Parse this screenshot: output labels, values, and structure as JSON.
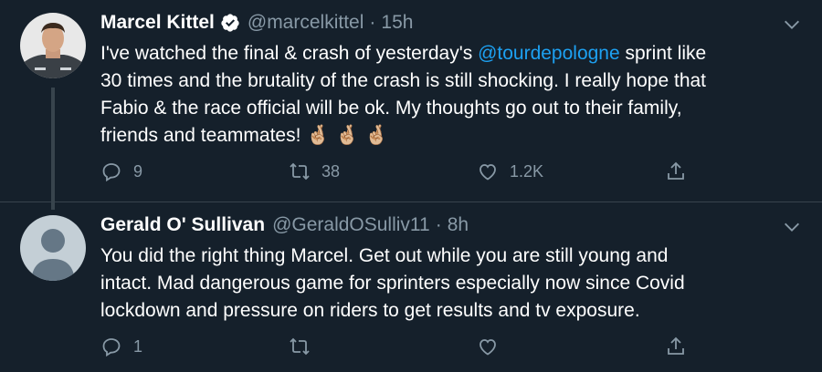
{
  "tweets": [
    {
      "name": "Marcel Kittel",
      "handle": "@marcelkittel",
      "separator": "·",
      "time": "15h",
      "verified": true,
      "text_lines": [
        {
          "parts": [
            {
              "t": "I've watched the final & crash of yesterday's ",
              "mention": false
            },
            {
              "t": "@tourdepologne",
              "mention": true
            },
            {
              "t": " sprint like",
              "mention": false
            }
          ]
        },
        {
          "parts": [
            {
              "t": "30 times and the brutality of the crash is still shocking. I really hope that",
              "mention": false
            }
          ]
        },
        {
          "parts": [
            {
              "t": "Fabio & the race official will be ok. My thoughts go out to their family,",
              "mention": false
            }
          ]
        },
        {
          "parts": [
            {
              "t": "friends and teammates!  🤞🏼 🤞🏼 🤞🏼",
              "mention": false
            }
          ]
        }
      ],
      "reply_count": "9",
      "retweet_count": "38",
      "like_count": "1.2K",
      "share_count": ""
    },
    {
      "name": "Gerald O' Sullivan",
      "handle": "@GeraldOSulliv11",
      "separator": "·",
      "time": "8h",
      "verified": false,
      "text_lines": [
        {
          "parts": [
            {
              "t": "You did the right thing Marcel. Get out while you are still young and",
              "mention": false
            }
          ]
        },
        {
          "parts": [
            {
              "t": "intact. Mad dangerous game for sprinters especially now since Covid",
              "mention": false
            }
          ]
        },
        {
          "parts": [
            {
              "t": "lockdown and pressure on riders to get results and tv exposure.",
              "mention": false
            }
          ]
        }
      ],
      "reply_count": "1",
      "retweet_count": "",
      "like_count": "",
      "share_count": ""
    }
  ],
  "colors": {
    "background": "#15202b",
    "text": "#ffffff",
    "secondary": "#8899a6",
    "accent": "#1da1f2",
    "divider": "#38444d"
  },
  "icons": [
    "verified-badge-icon",
    "chevron-down-icon",
    "reply-icon",
    "retweet-icon",
    "like-icon",
    "share-icon",
    "default-avatar-icon"
  ]
}
